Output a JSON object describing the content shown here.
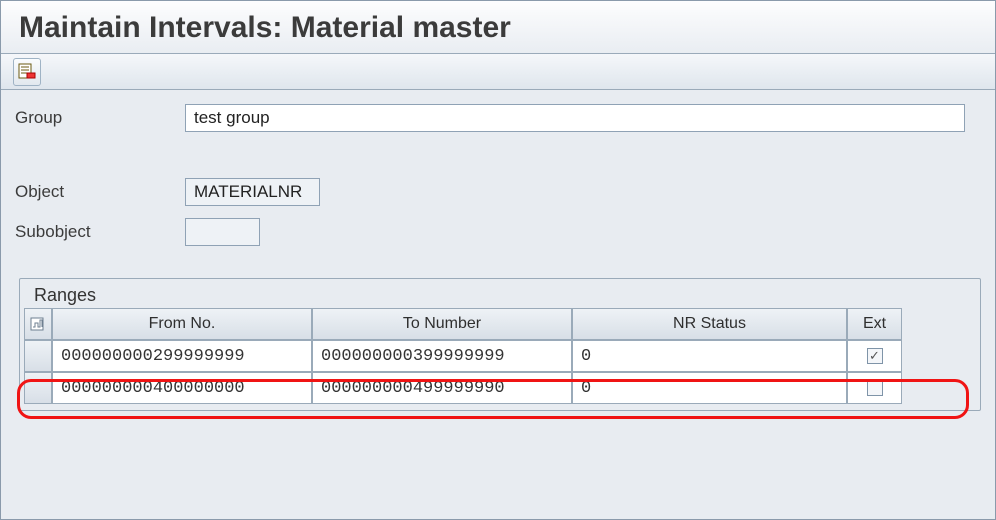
{
  "title": "Maintain Intervals: Material master",
  "toolbar": {
    "btn": "intervals-icon"
  },
  "form": {
    "group_label": "Group",
    "group_value": "test group",
    "object_label": "Object",
    "object_value": "MATERIALNR",
    "subobject_label": "Subobject",
    "subobject_value": ""
  },
  "ranges": {
    "title": "Ranges",
    "columns": {
      "from": "From No.",
      "to": "To Number",
      "status": "NR Status",
      "ext": "Ext"
    },
    "rows": [
      {
        "from": "000000000299999999",
        "to": "000000000399999999",
        "status": "0",
        "ext": true
      },
      {
        "from": "000000000400000000",
        "to": "000000000499999990",
        "status": "0",
        "ext": false
      }
    ]
  }
}
